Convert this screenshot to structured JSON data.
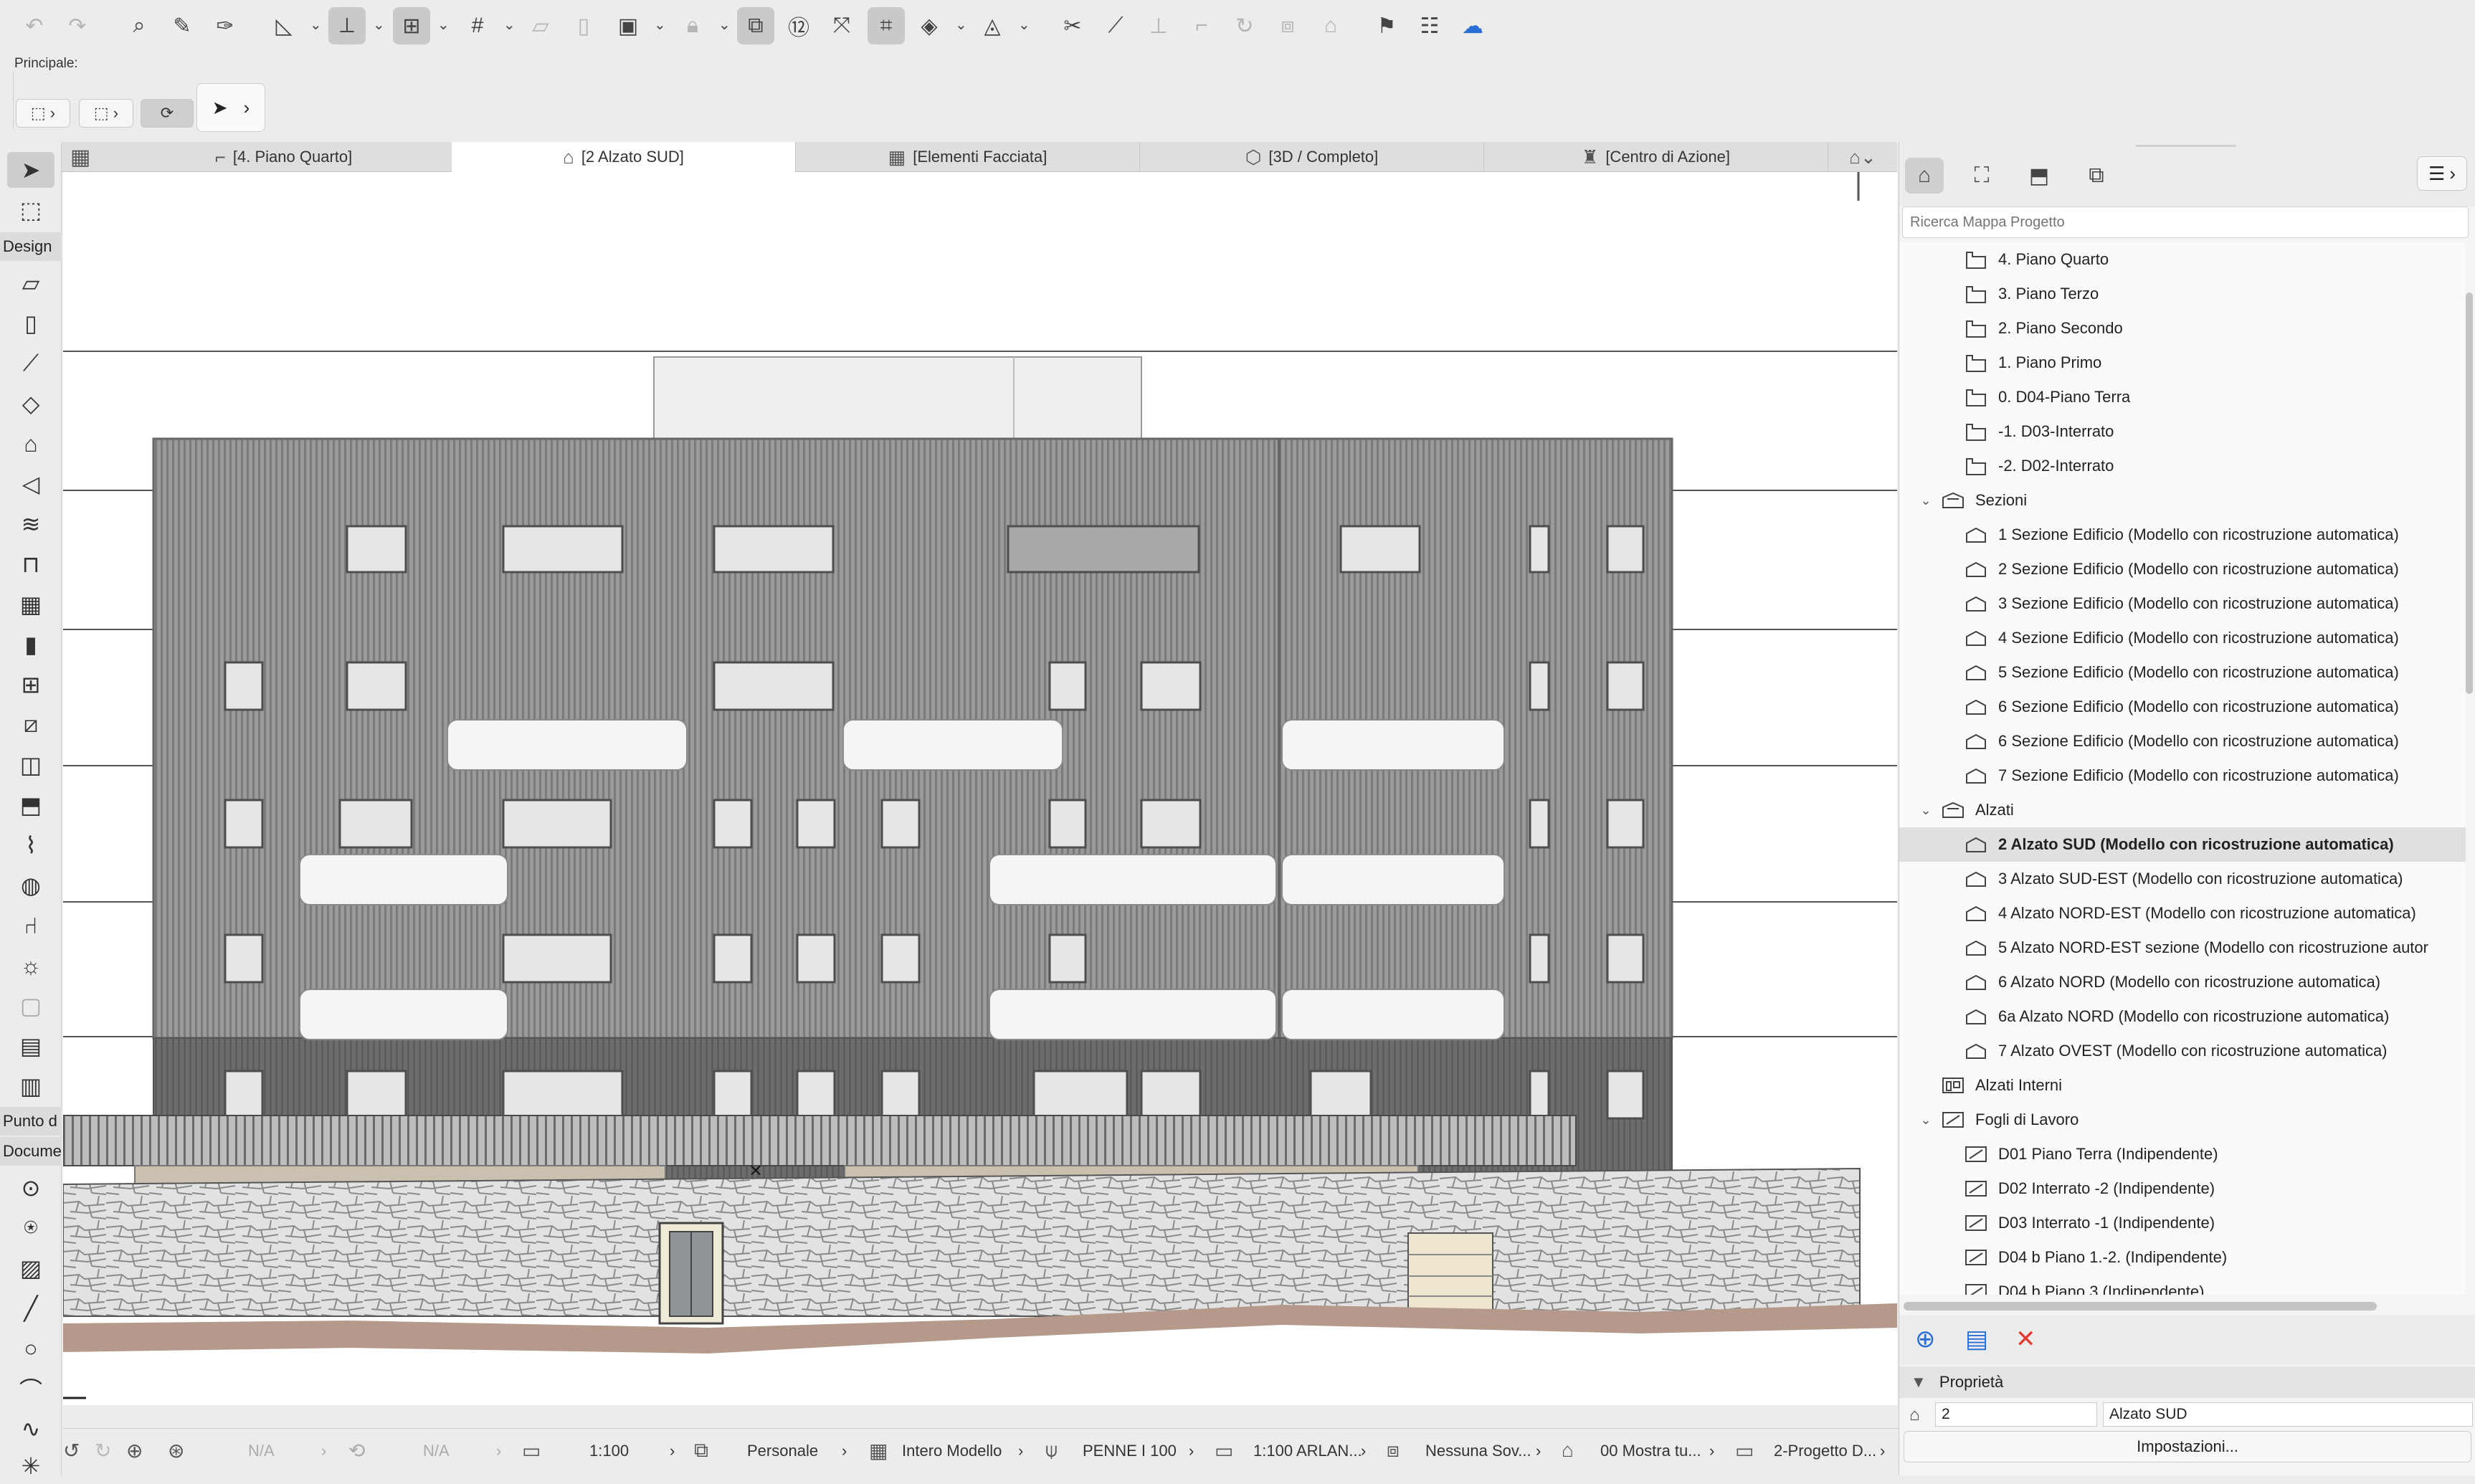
{
  "toolbar": {
    "icons": [
      "undo-icon",
      "redo-icon",
      "find-select-icon",
      "eyedropper-icon",
      "syringe-icon",
      "guide-lines-icon",
      "snap-guides-icon",
      "snap-points-icon",
      "grid-snap-icon",
      "suspend-groups-icon",
      "layer-icon",
      "section-view-icon",
      "lock-icon",
      "trace-icon",
      "renovation-icon",
      "measure-icon",
      "magic-wand-icon",
      "marquee-icon",
      "view-tools-icon",
      "shape-tools-icon",
      "trim-icon",
      "split-icon",
      "adjust-icon",
      "intersect-icon",
      "fillet-icon",
      "offset-icon",
      "resize-icon",
      "roof-icon",
      "flag-icon",
      "markup-icon",
      "cloud-icon"
    ]
  },
  "info_box": {
    "label": "Principale:"
  },
  "toolbox": {
    "design_label": "Design",
    "punto_label": "Punto d",
    "docum_label": "Docume"
  },
  "tabs": [
    {
      "label": "[4. Piano Quarto]",
      "icon": "floor-plan-icon"
    },
    {
      "label": "[2 Alzato SUD]",
      "icon": "elevation-icon",
      "active": true
    },
    {
      "label": "[Elementi Facciata]",
      "icon": "curtain-wall-icon"
    },
    {
      "label": "[3D / Completo]",
      "icon": "3d-cube-icon"
    },
    {
      "label": "[Centro di Azione]",
      "icon": "action-center-icon"
    }
  ],
  "navigator": {
    "search_placeholder": "Ricerca Mappa Progetto",
    "items": [
      {
        "label": "4. Piano Quarto",
        "level": 2,
        "type": "story"
      },
      {
        "label": "3. Piano Terzo",
        "level": 2,
        "type": "story"
      },
      {
        "label": "2. Piano Secondo",
        "level": 2,
        "type": "story"
      },
      {
        "label": "1. Piano Primo",
        "level": 2,
        "type": "story"
      },
      {
        "label": "0. D04-Piano Terra",
        "level": 2,
        "type": "story"
      },
      {
        "label": "-1. D03-Interrato",
        "level": 2,
        "type": "story"
      },
      {
        "label": "-2. D02-Interrato",
        "level": 2,
        "type": "story"
      },
      {
        "label": "Sezioni",
        "level": 1,
        "type": "folder",
        "expanded": true
      },
      {
        "label": "1 Sezione Edificio (Modello con ricostruzione automatica)",
        "level": 2,
        "type": "section"
      },
      {
        "label": "2 Sezione Edificio (Modello con ricostruzione automatica)",
        "level": 2,
        "type": "section"
      },
      {
        "label": "3 Sezione Edificio (Modello con ricostruzione automatica)",
        "level": 2,
        "type": "section"
      },
      {
        "label": "4 Sezione Edificio (Modello con ricostruzione automatica)",
        "level": 2,
        "type": "section"
      },
      {
        "label": "5 Sezione Edificio (Modello con ricostruzione automatica)",
        "level": 2,
        "type": "section"
      },
      {
        "label": "6 Sezione Edificio (Modello con ricostruzione automatica)",
        "level": 2,
        "type": "section"
      },
      {
        "label": "6 Sezione Edificio (Modello con ricostruzione automatica)",
        "level": 2,
        "type": "section"
      },
      {
        "label": "7 Sezione Edificio (Modello con ricostruzione automatica)",
        "level": 2,
        "type": "section"
      },
      {
        "label": "Alzati",
        "level": 1,
        "type": "folder",
        "expanded": true
      },
      {
        "label": "2 Alzato SUD (Modello con ricostruzione automatica)",
        "level": 2,
        "type": "elevation",
        "selected": true
      },
      {
        "label": "3 Alzato SUD-EST (Modello con ricostruzione automatica)",
        "level": 2,
        "type": "elevation"
      },
      {
        "label": "4 Alzato NORD-EST (Modello con ricostruzione automatica)",
        "level": 2,
        "type": "elevation"
      },
      {
        "label": "5 Alzato NORD-EST sezione (Modello con ricostruzione autor",
        "level": 2,
        "type": "elevation"
      },
      {
        "label": "6 Alzato NORD (Modello con ricostruzione automatica)",
        "level": 2,
        "type": "elevation"
      },
      {
        "label": "6a Alzato NORD (Modello con ricostruzione automatica)",
        "level": 2,
        "type": "elevation"
      },
      {
        "label": "7 Alzato OVEST (Modello con ricostruzione automatica)",
        "level": 2,
        "type": "elevation"
      },
      {
        "label": "Alzati Interni",
        "level": 1,
        "type": "interior"
      },
      {
        "label": "Fogli di Lavoro",
        "level": 1,
        "type": "worksheet-folder",
        "expanded": true
      },
      {
        "label": "D01 Piano Terra (Indipendente)",
        "level": 2,
        "type": "worksheet"
      },
      {
        "label": "D02 Interrato -2 (Indipendente)",
        "level": 2,
        "type": "worksheet"
      },
      {
        "label": "D03 Interrato -1 (Indipendente)",
        "level": 2,
        "type": "worksheet"
      },
      {
        "label": "D04 b Piano 1.-2.  (Indipendente)",
        "level": 2,
        "type": "worksheet"
      },
      {
        "label": "D04 b Piano 3 (Indipendente)",
        "level": 2,
        "type": "worksheet"
      }
    ]
  },
  "properties": {
    "title": "Proprietà",
    "ref_id": "2",
    "name": "Alzato SUD",
    "settings_button": "Impostazioni..."
  },
  "statusbar": {
    "na1": "N/A",
    "na2": "N/A",
    "scale": "1:100",
    "layer_combo": "Personale",
    "model_view": "Intero Modello",
    "pen_set": "PENNE I 100",
    "mvo": "1:100 ARLAN...",
    "override": "Nessuna Sov...",
    "renovation": "00 Mostra tu...",
    "dimension": "2-Progetto D..."
  },
  "colors": {
    "facade": "#8f8f8f",
    "ground_floor": "#6a6a6a",
    "stone": "#d2d2d2",
    "terrain": "#b59a8b",
    "selection": "#e0e0e0",
    "delete_red": "#e23a2e",
    "add_blue": "#2a6fd6"
  }
}
